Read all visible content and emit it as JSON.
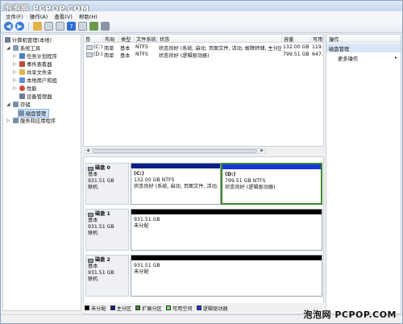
{
  "watermark": {
    "top": "泡泡网 PCPOP.COM",
    "bottom": "泡泡网 PCPOP.COM"
  },
  "menu": [
    "文件(F)",
    "操作(A)",
    "查看(V)",
    "帮助(H)"
  ],
  "toolbar_icons": [
    "back-icon",
    "forward-icon",
    "folder-icon",
    "properties-icon",
    "list-icon",
    "help-icon",
    "grid-icon",
    "export-icon",
    "settings-icon"
  ],
  "tree": {
    "items": [
      {
        "label": "计算机管理(本地)",
        "level": 0,
        "expander": "",
        "icon": "computer-icon",
        "color": "#6b7c93"
      },
      {
        "label": "系统工具",
        "level": 1,
        "expander": "◢",
        "icon": "tools-icon",
        "color": "#8a9bb0"
      },
      {
        "label": "任务计划程序",
        "level": 2,
        "expander": "▷",
        "icon": "clock-icon",
        "color": "#4d7fc4"
      },
      {
        "label": "事件查看器",
        "level": 2,
        "expander": "▷",
        "icon": "event-icon",
        "color": "#c24a3a"
      },
      {
        "label": "共享文件夹",
        "level": 2,
        "expander": "▷",
        "icon": "folder-icon",
        "color": "#e5b445"
      },
      {
        "label": "本地用户和组",
        "level": 2,
        "expander": "▷",
        "icon": "users-icon",
        "color": "#5d8fd6"
      },
      {
        "label": "性能",
        "level": 2,
        "expander": "▷",
        "icon": "performance-icon",
        "color": "#d04a3a"
      },
      {
        "label": "设备管理器",
        "level": 2,
        "expander": "",
        "icon": "device-icon",
        "color": "#6a7d96"
      },
      {
        "label": "存储",
        "level": 1,
        "expander": "◢",
        "icon": "storage-icon",
        "color": "#7b8ea8"
      },
      {
        "label": "磁盘管理",
        "level": 2,
        "expander": "",
        "icon": "disk-icon",
        "color": "#7b8ea8",
        "selected": true
      },
      {
        "label": "服务和应用程序",
        "level": 1,
        "expander": "▷",
        "icon": "services-icon",
        "color": "#7b8ea8"
      }
    ]
  },
  "volume_table": {
    "columns": [
      "卷",
      "布局",
      "类型",
      "文件系统",
      "状态",
      "容量",
      "可用"
    ],
    "rows": [
      [
        "(C:)",
        "简单",
        "基本",
        "NTFS",
        "状态良好 (系统, 启动, 页面文件, 活动, 故障转储, 主分区)",
        "132.00 GB",
        "119."
      ],
      [
        "(D:)",
        "简单",
        "基本",
        "NTFS",
        "状态良好 (逻辑驱动器)",
        "799.51 GB",
        "647."
      ]
    ]
  },
  "disks": [
    {
      "name": "磁盘 0",
      "type": "基本",
      "size": "931.51 GB",
      "status": "联机",
      "partitions": [
        {
          "label": "(C:)",
          "size": "132.00 GB NTFS",
          "status": "状态良好 (系统, 启动, 页面文件, 活动,",
          "bar_color": "#0a1f8a",
          "selected": false
        },
        {
          "label": "(D:)",
          "size": "799.51 GB NTFS",
          "status": "状态良好 (逻辑驱动器)",
          "bar_color": "#1436e0",
          "selected": true
        }
      ]
    },
    {
      "name": "磁盘 1",
      "type": "基本",
      "size": "931.51 GB",
      "status": "联机",
      "partitions": [
        {
          "label": "",
          "size": "931.51 GB",
          "status": "未分配",
          "bar_color": "#000000",
          "selected": false
        }
      ]
    },
    {
      "name": "磁盘 2",
      "type": "基本",
      "size": "931.51 GB",
      "status": "联机",
      "partitions": [
        {
          "label": "",
          "size": "931.51 GB",
          "status": "未分配",
          "bar_color": "#000000",
          "selected": false
        }
      ]
    }
  ],
  "legend": [
    {
      "label": "未分配",
      "color": "#000000"
    },
    {
      "label": "主分区",
      "color": "#0a1f8a"
    },
    {
      "label": "扩展分区",
      "color": "#3a8a2a"
    },
    {
      "label": "可用空间",
      "color": "#66ee55"
    },
    {
      "label": "逻辑驱动器",
      "color": "#1436e0"
    }
  ],
  "actions": {
    "header": "操作",
    "section": "磁盘管理",
    "more": "更多操作",
    "arrow": "▸"
  }
}
